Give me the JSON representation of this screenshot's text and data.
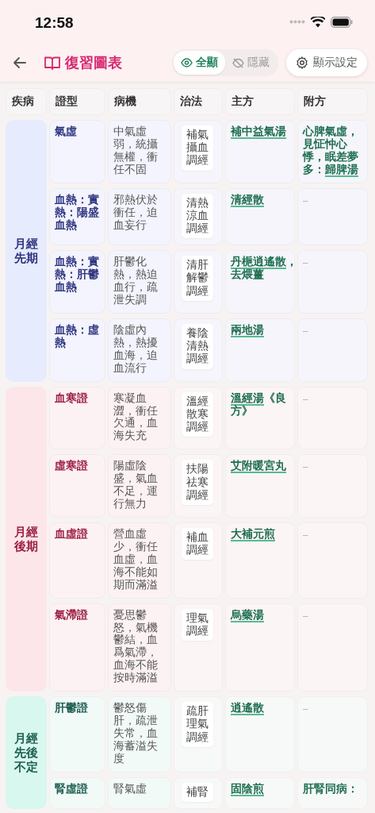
{
  "status_bar": {
    "time": "12:58"
  },
  "nav": {
    "title": "復習圖表",
    "filters": [
      {
        "label": "全顯",
        "selected": true
      },
      {
        "label": "隱藏",
        "selected": false
      }
    ],
    "settings_button": "顯示設定"
  },
  "table": {
    "columns": [
      "疾病",
      "證型",
      "病機",
      "治法",
      "主方",
      "附方"
    ],
    "groups": [
      {
        "disease": "月經先期",
        "kind": "blue",
        "rows": [
          {
            "syndrome": "氣虛",
            "mechanism": "中氣虛弱，統攝無權，衝任不固",
            "method": "補氣攝血調經",
            "main": [
              {
                "kind": "formula",
                "text": "補中益氣湯"
              }
            ],
            "extra": [
              {
                "kind": "text",
                "text": "心脾氣虛，見怔忡心悸，眠差夢多："
              },
              {
                "kind": "formula",
                "text": "歸脾湯"
              }
            ]
          },
          {
            "syndrome": "血熱：實熱：陽盛血熱",
            "mechanism": "邪熱伏於衝任，迫血妄行",
            "method": "清熱涼血調經",
            "main": [
              {
                "kind": "formula",
                "text": "清經散"
              }
            ],
            "extra": [
              {
                "kind": "dash",
                "text": "–"
              }
            ]
          },
          {
            "syndrome": "血熱：實熱：肝鬱血熱",
            "mechanism": "肝鬱化熱，熱迫血行，疏泄失調",
            "method": "清肝解鬱調經",
            "main": [
              {
                "kind": "formula",
                "text": "丹梔逍遙散"
              },
              {
                "kind": "text",
                "text": "，去煨薑"
              }
            ],
            "extra": [
              {
                "kind": "dash",
                "text": "–"
              }
            ]
          },
          {
            "syndrome": "血熱：虛熱",
            "mechanism": "陰虛內熱，熱擾血海，迫血流行",
            "method": "養陰清熱調經",
            "main": [
              {
                "kind": "formula",
                "text": "兩地湯"
              }
            ],
            "extra": [
              {
                "kind": "dash",
                "text": "–"
              }
            ]
          }
        ]
      },
      {
        "disease": "月經後期",
        "kind": "red",
        "rows": [
          {
            "syndrome": "血寒證",
            "mechanism": "寒凝血澀，衝任欠通，血海失充",
            "method": "溫經散寒調經",
            "main": [
              {
                "kind": "formula",
                "text": "溫經湯"
              },
              {
                "kind": "text",
                "text": "《良方》"
              }
            ],
            "extra": [
              {
                "kind": "dash",
                "text": "–"
              }
            ]
          },
          {
            "syndrome": "虛寒證",
            "mechanism": "陽虛陰盛，氣血不足，運行無力",
            "method": "扶陽祛寒調經",
            "main": [
              {
                "kind": "formula",
                "text": "艾附暖宮丸"
              }
            ],
            "extra": [
              {
                "kind": "dash",
                "text": "–"
              }
            ]
          },
          {
            "syndrome": "血虛證",
            "mechanism": "營血虛少，衝任血虛，血海不能如期而滿溢",
            "method": "補血調經",
            "main": [
              {
                "kind": "formula",
                "text": "大補元煎"
              }
            ],
            "extra": [
              {
                "kind": "dash",
                "text": "–"
              }
            ]
          },
          {
            "syndrome": "氣滯證",
            "mechanism": "憂思鬱怒，氣機鬱結，血爲氣滯，血海不能按時滿溢",
            "method": "理氣調經",
            "main": [
              {
                "kind": "formula",
                "text": "烏藥湯"
              }
            ],
            "extra": [
              {
                "kind": "dash",
                "text": "–"
              }
            ]
          }
        ]
      },
      {
        "disease": "月經先後不定",
        "kind": "green",
        "rows": [
          {
            "syndrome": "肝鬱證",
            "mechanism": "鬱怒傷肝，疏泄失常，血海蓄溢失度",
            "method": "疏肝理氣調經",
            "main": [
              {
                "kind": "formula",
                "text": "逍遙散"
              }
            ],
            "extra": [
              {
                "kind": "dash",
                "text": "–"
              }
            ]
          },
          {
            "syndrome": "腎虛證",
            "mechanism": "腎氣虛",
            "method": "補腎",
            "main": [
              {
                "kind": "formula",
                "text": "固陰煎"
              }
            ],
            "extra": [
              {
                "kind": "text",
                "text": "肝腎同病："
              }
            ]
          }
        ]
      }
    ]
  }
}
